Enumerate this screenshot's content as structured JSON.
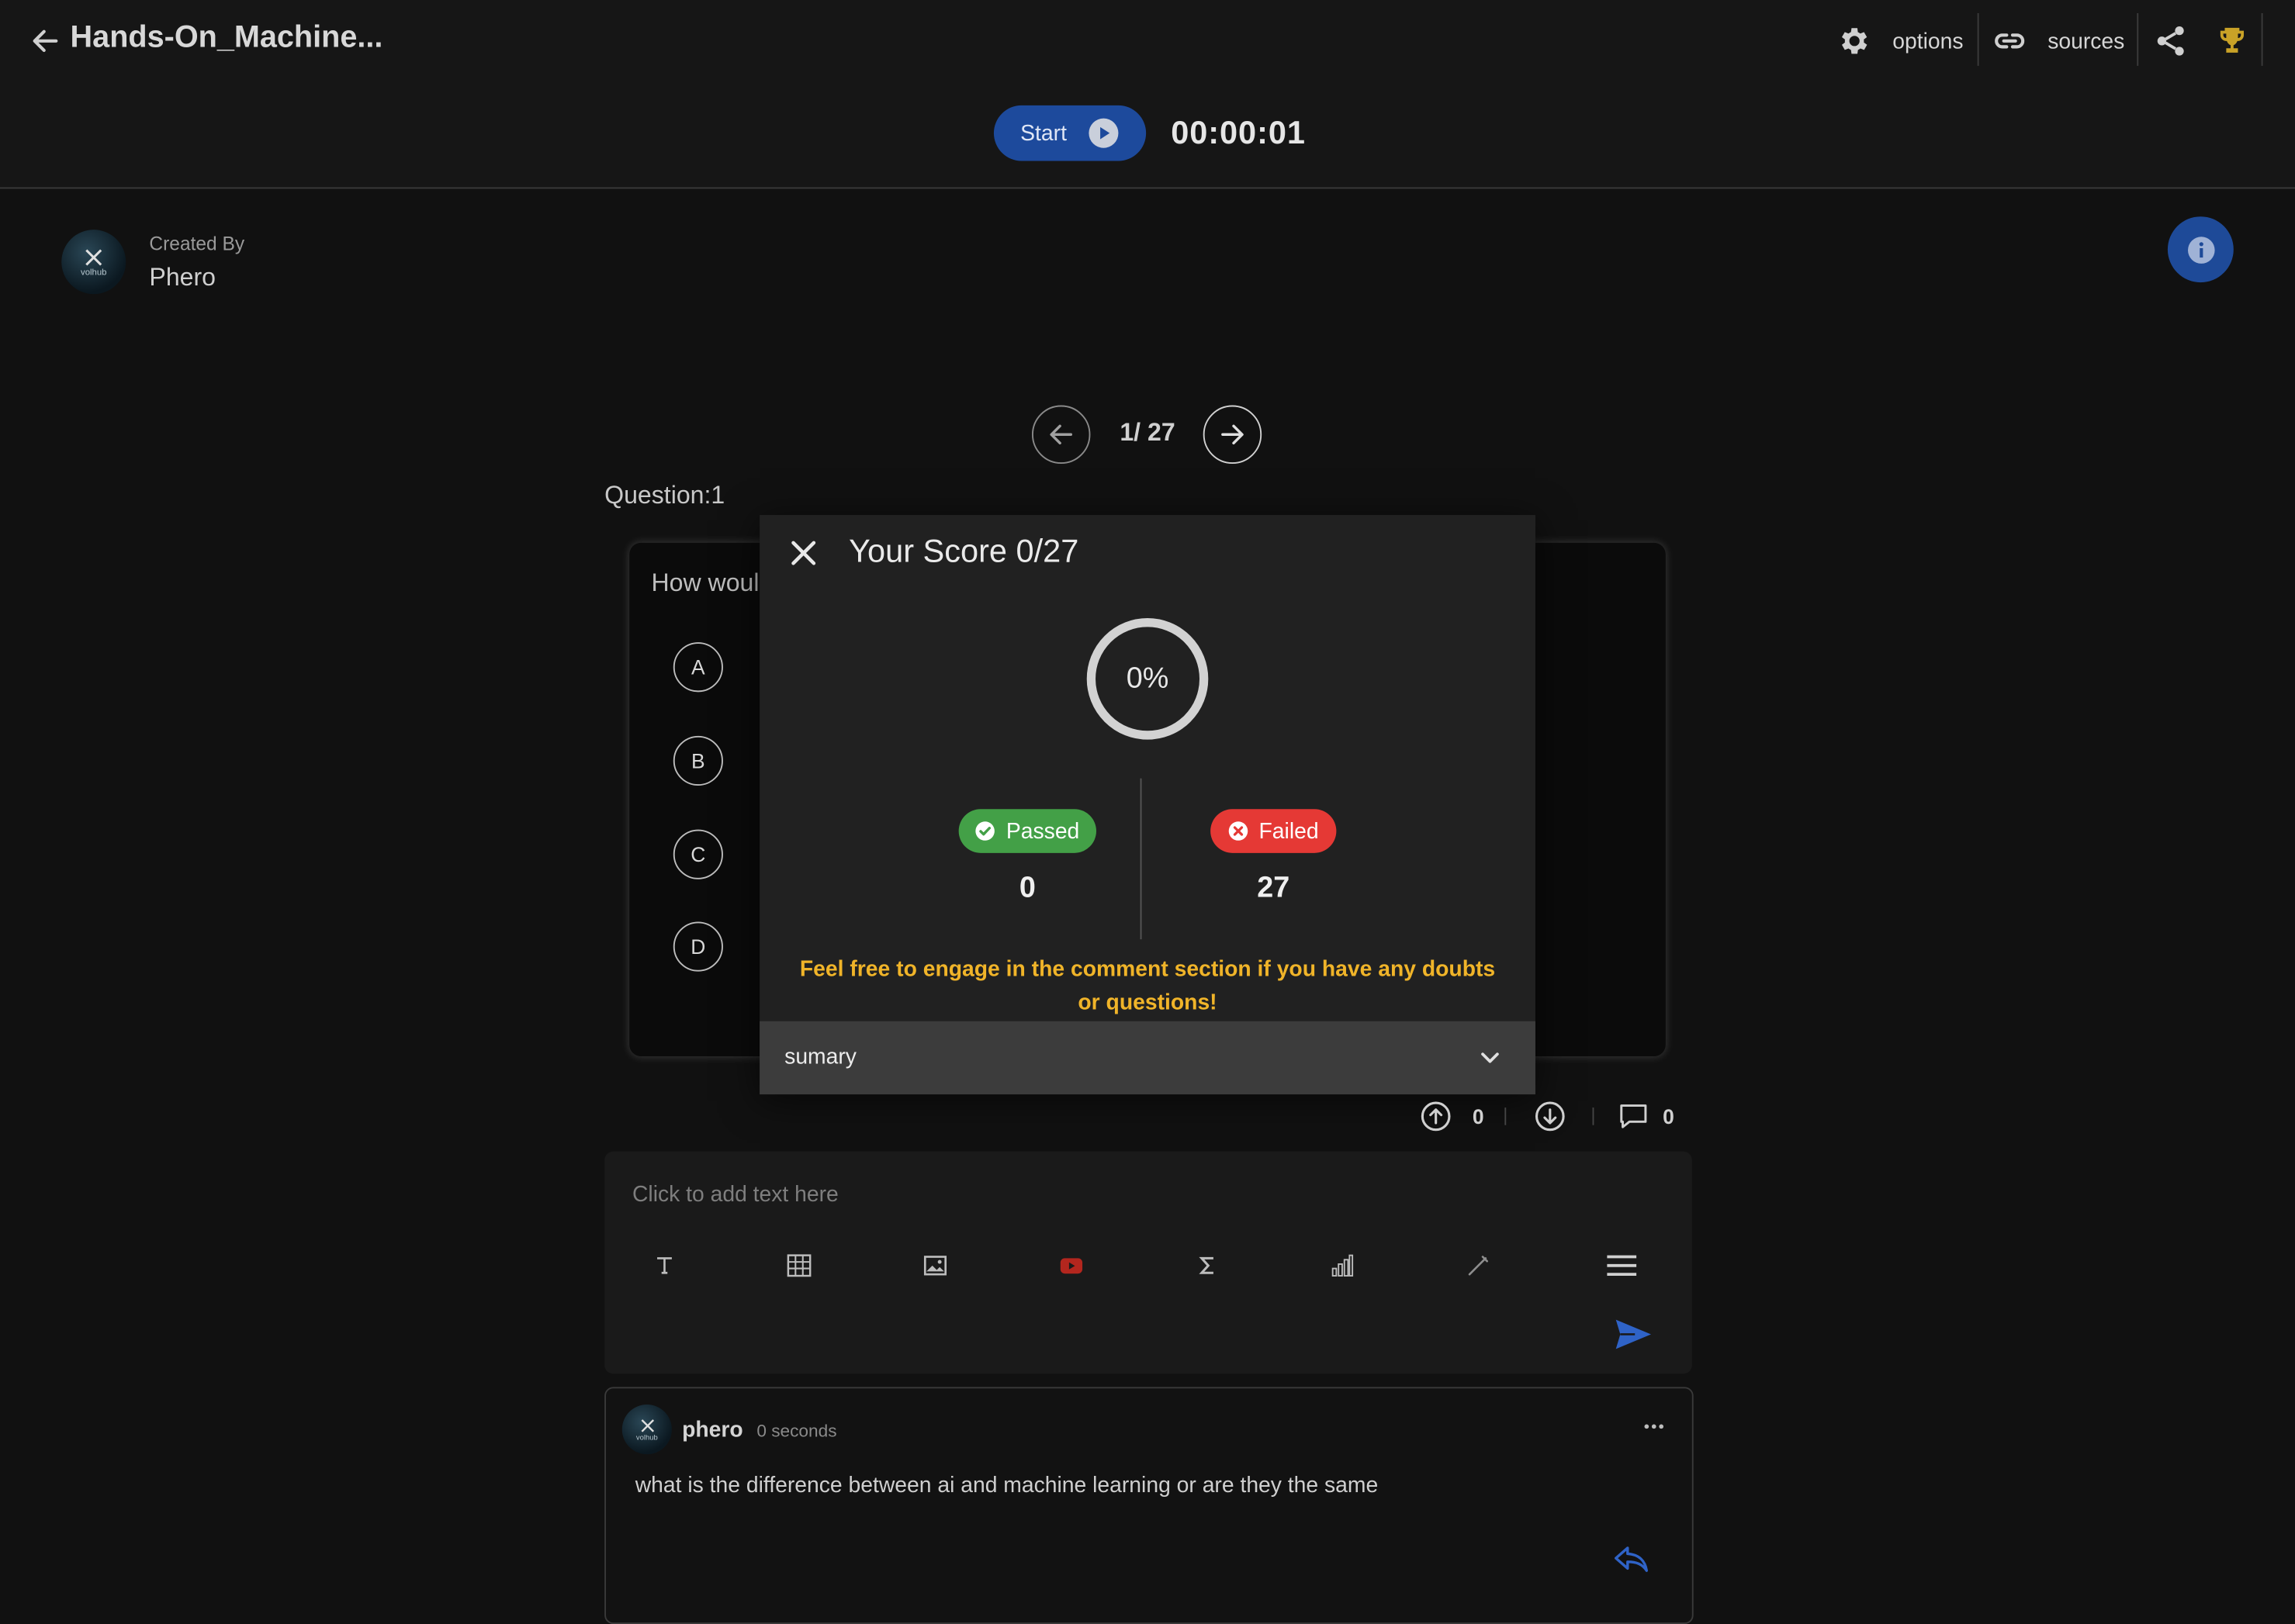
{
  "header": {
    "title": "Hands-On_Machine...",
    "options_label": "options",
    "sources_label": "sources",
    "start_label": "Start",
    "timer": "00:00:01"
  },
  "creator": {
    "created_by_label": "Created By",
    "name": "Phero",
    "avatar_text": "volhub"
  },
  "pager": {
    "indicator": "1/ 27"
  },
  "question": {
    "label": "Question:1",
    "text_partial": "How woul",
    "options": [
      "A",
      "B",
      "C",
      "D"
    ]
  },
  "score_modal": {
    "title": "Your Score 0/27",
    "percent_label": "0%",
    "percent": 0,
    "passed_label": "Passed",
    "passed_count": "0",
    "failed_label": "Failed",
    "failed_count": "27",
    "note": "Feel free to engage in the comment section if you have any doubts or questions!",
    "summary_label": "sumary"
  },
  "votes": {
    "upvotes": "0",
    "comments": "0"
  },
  "editor": {
    "placeholder": "Click to add text here"
  },
  "comment": {
    "user": "phero",
    "time": "0 seconds",
    "text": "what is the  difference between ai and machine learning or are they the same"
  },
  "colors": {
    "accent_blue": "#1e4a98",
    "passed_green": "#43a047",
    "failed_red": "#e53935",
    "note_yellow": "#f0b429",
    "trophy_gold": "#c9a227"
  },
  "icons": {
    "back": "arrow-left-icon",
    "options": "gear-icon",
    "sources": "link-icon",
    "share": "share-icon",
    "leaderboard": "trophy-icon",
    "play": "play-icon",
    "info": "info-icon",
    "close": "close-icon",
    "expand": "chevron-down-icon",
    "send": "send-icon",
    "reply": "reply-icon",
    "more": "more-horizontal-icon"
  }
}
